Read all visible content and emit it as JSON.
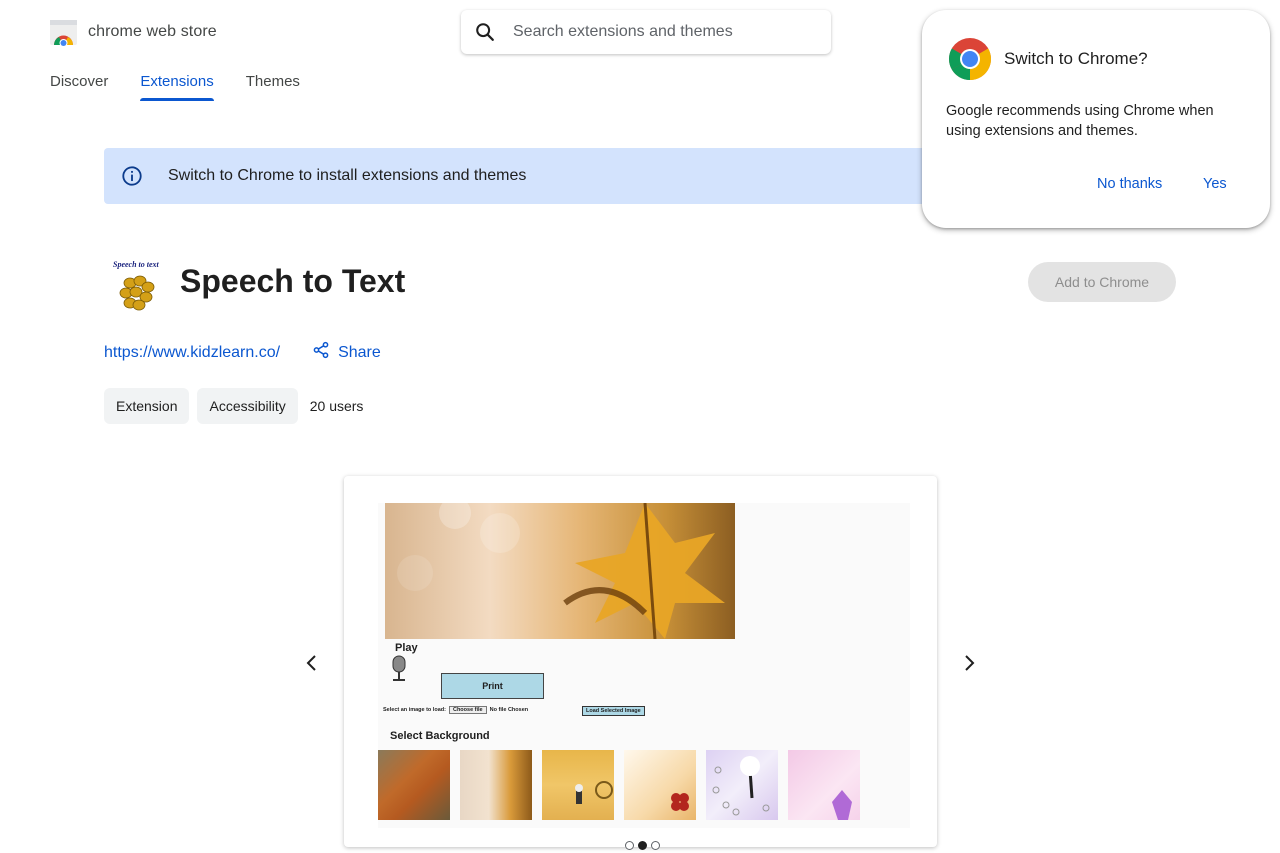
{
  "header": {
    "store_name": "chrome web store",
    "search_placeholder": "Search extensions and themes"
  },
  "nav": {
    "tabs": [
      {
        "label": "Discover",
        "active": false
      },
      {
        "label": "Extensions",
        "active": true
      },
      {
        "label": "Themes",
        "active": false
      }
    ]
  },
  "banner": {
    "text": "Switch to Chrome to install extensions and themes"
  },
  "item": {
    "icon_label": "Speech to text",
    "title": "Speech to Text",
    "add_button": "Add to Chrome",
    "website": "https://www.kidzlearn.co/",
    "share_label": "Share",
    "chips": [
      "Extension",
      "Accessibility"
    ],
    "users": "20 users"
  },
  "screenshot": {
    "play_label": "Play",
    "print_label": "Print",
    "select_image_label": "Select an image to load:",
    "choose_file_label": "Choose file",
    "no_file_label": "No file Chosen",
    "load_button_label": "Load Selected Image",
    "select_background_label": "Select Background"
  },
  "carousel": {
    "slide_count": 3,
    "active_index": 1
  },
  "popup": {
    "title": "Switch to Chrome?",
    "body": "Google recommends using Chrome when using extensions and themes.",
    "no_label": "No thanks",
    "yes_label": "Yes"
  },
  "colors": {
    "accent": "#0b57d0",
    "banner_bg": "#d3e3fd",
    "disabled_button_bg": "#e3e3e3"
  }
}
